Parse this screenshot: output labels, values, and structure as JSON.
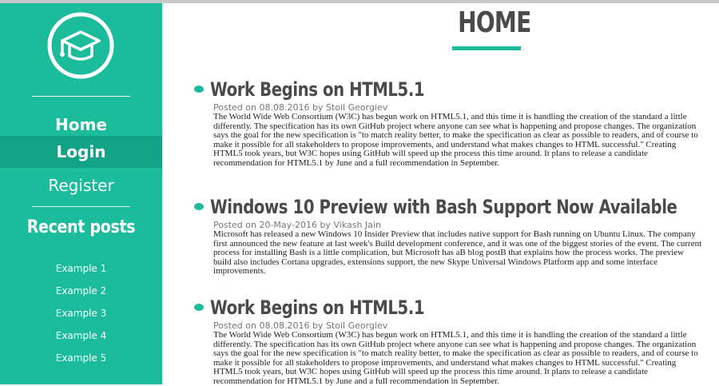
{
  "colors": {
    "accent": "#1abc9c",
    "accent_dark": "#12a386",
    "heading": "#4a4a4a"
  },
  "sidebar": {
    "logo_icon": "graduation-cap-logo",
    "nav": {
      "home": "Home",
      "login": "Login",
      "register": "Register"
    },
    "recent_title": "Recent posts",
    "recent_items": [
      "Example 1",
      "Example 2",
      "Example 3",
      "Example 4",
      "Example 5"
    ]
  },
  "main": {
    "page_title": "HOME",
    "posts": [
      {
        "title": "Work Begins on HTML5.1",
        "posted_on": "Posted on",
        "date": "08.08.2016",
        "by": "by",
        "author": "Stoil Georgiev",
        "body": "The World Wide Web Consortium (W3C) has begun work on HTML5.1, and this time it is handling the creation of the standard a little differently. The specification has its own GitHub project where anyone can see what is happening and propose changes. The organization says the goal for the new specification is \"to match reality better, to make the specification as clear as possible to readers, and of course to make it possible for all stakeholders to propose improvements, and understand what makes changes to HTML successful.\" Creating HTML5 took years, but W3C hopes using GitHub will speed up the process this time around. It plans to release a candidate recommendation for HTML5.1 by June and a full recommendation in September."
      },
      {
        "title": "Windows 10 Preview with Bash Support Now Available",
        "posted_on": "Posted on",
        "date": "20-May-2016",
        "by": "by",
        "author": "Vikash Jain",
        "body": "Microsoft has released a new Windows 10 Insider Preview that includes native support for Bash running on Ubuntu Linux. The company first announced the new feature at last week's Build development conference, and it was one of the biggest stories of the event. The current process for installing Bash is a little complication, but Microsoft has aB blog postB that explains how the process works. The preview build also includes Cortana upgrades, extensions support, the new Skype Universal Windows Platform app and some interface improvements."
      },
      {
        "title": "Work Begins on HTML5.1",
        "posted_on": "Posted on",
        "date": "08.08.2016",
        "by": "by",
        "author": "Stoil Georgiev",
        "body": "The World Wide Web Consortium (W3C) has begun work on HTML5.1, and this time it is handling the creation of the standard a little differently. The specification has its own GitHub project where anyone can see what is happening and propose changes. The organization says the goal for the new specification is \"to match reality better, to make the specification as clear as possible to readers, and of course to make it possible for all stakeholders to propose improvements, and understand what makes changes to HTML successful.\" Creating HTML5 took years, but W3C hopes using GitHub will speed up the process this time around. It plans to release a candidate recommendation for HTML5.1 by June and a full recommendation in September."
      }
    ]
  }
}
